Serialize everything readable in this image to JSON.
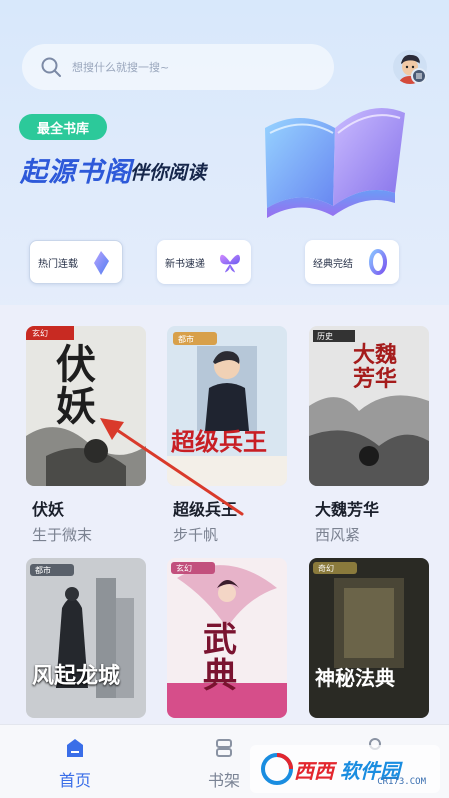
{
  "search": {
    "placeholder": "想搜什么就搜一搜~"
  },
  "header": {
    "badge": "最全书库",
    "brand": "起源书阁",
    "slogan": "伴你阅读"
  },
  "shortcuts": [
    {
      "label": "热门连载",
      "icon": "crystal-icon",
      "active": true
    },
    {
      "label": "新书速递",
      "icon": "butterfly-icon",
      "active": false
    },
    {
      "label": "经典完结",
      "icon": "ring-icon",
      "active": false
    }
  ],
  "books": [
    {
      "title": "伏妖",
      "author": "生于微末",
      "cover_text": "伏妖",
      "tag": "玄幻"
    },
    {
      "title": "超级兵王",
      "author": "步千帆",
      "cover_text": "超级兵王",
      "tag": "都市"
    },
    {
      "title": "大魏芳华",
      "author": "西风紧",
      "cover_text": "大魏芳华",
      "tag": "历史"
    },
    {
      "title": "",
      "author": "",
      "cover_text": "风起龙城",
      "tag": "都市"
    },
    {
      "title": "",
      "author": "",
      "cover_text": "武典",
      "tag": "玄幻"
    },
    {
      "title": "",
      "author": "",
      "cover_text": "神秘法典",
      "tag": "奇幻"
    }
  ],
  "tabbar": {
    "home": "首页",
    "shelf": "书架"
  },
  "watermark": {
    "cn1": "西西",
    "cn2": "软件园",
    "url": "CR173.COM"
  },
  "colors": {
    "accent": "#2d59d9",
    "badge": "#2cc99a",
    "tab_active": "#3a6ee8",
    "arrow": "#d93a2b"
  }
}
